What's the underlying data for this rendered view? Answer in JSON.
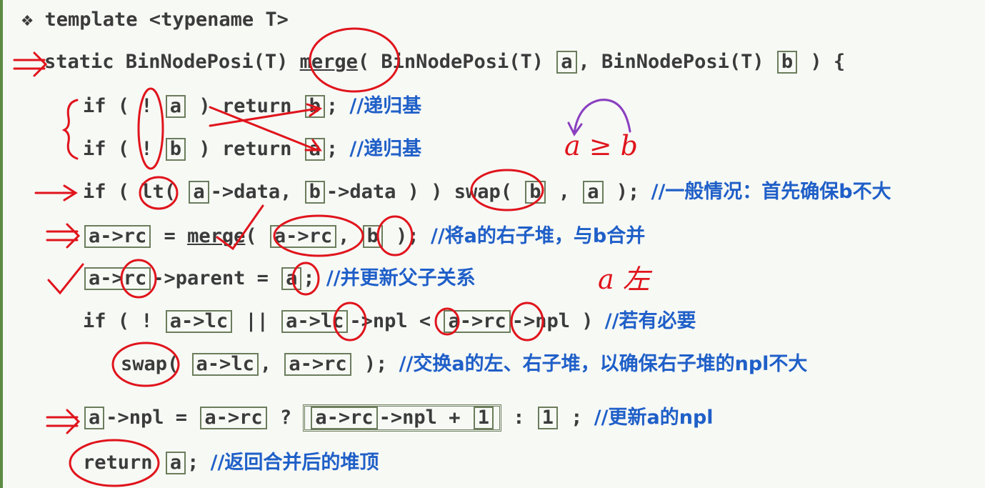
{
  "lines": {
    "l1": "❖ template <typename T>",
    "l2a": "static BinNodePosi(T) ",
    "l2b": "merge",
    "l2c": "( BinNodePosi(T) ",
    "l2d": "a",
    "l2e": ", BinNodePosi(T) ",
    "l2f": "b",
    "l2g": " ) {",
    "l3a": "if ( ! ",
    "l3b": "a",
    "l3c": " ) return ",
    "l3d": "b",
    "l3e": "; ",
    "l3f": "//递归基",
    "l4a": "if ( ! ",
    "l4b": "b",
    "l4c": " ) return ",
    "l4d": "a",
    "l4e": "; ",
    "l4f": "//递归基",
    "l5a": "if ( lt( ",
    "l5b": "a",
    "l5c": "->data, ",
    "l5d": "b",
    "l5e": "->data ) ) swap( ",
    "l5f": "b",
    "l5g": " , ",
    "l5h": "a",
    "l5i": " ); ",
    "l5j": "//一般情况：首先确保b不大",
    "l6a": "a->rc",
    "l6b": " = ",
    "l6c": "merge",
    "l6d": "( ",
    "l6e": "a->rc",
    "l6f": ", ",
    "l6g": "b",
    "l6h": " ); ",
    "l6i": "//将a的右子堆，与b合并",
    "l7a": "a->rc",
    "l7b": "->parent = ",
    "l7c": "a",
    "l7d": "; ",
    "l7e": "//并更新父子关系",
    "l8a": "if ( ! ",
    "l8b": "a->lc",
    "l8c": " || ",
    "l8d": "a->lc",
    "l8e": "->npl < ",
    "l8f": "a->rc",
    "l8g": "->npl ) ",
    "l8h": "//若有必要",
    "l9a": "swap( ",
    "l9b": "a->lc",
    "l9c": ", ",
    "l9d": "a->rc",
    "l9e": " ); ",
    "l9f": "//交换a的左、右子堆，以确保右子堆的npl不大",
    "l10a": "a",
    "l10b": "->npl = ",
    "l10c": "a->rc",
    "l10d": " ? ",
    "l10e": "a->rc",
    "l10f": "->npl + ",
    "l10g": "1",
    "l10h": " : ",
    "l10i": "1",
    "l10j": " ; ",
    "l10k": "//更新a的npl",
    "l11a": "return",
    "l11b": " ",
    "l11c": "a",
    "l11d": "; ",
    "l11e": "//返回合并后的堆顶"
  },
  "annotations": {
    "a_ge_b": "a ≥ b",
    "a_left": "a 左"
  },
  "colors": {
    "code": "#3b3b3b",
    "comment": "#1f5fc8",
    "ink": "#e0141c",
    "purple": "#8a3fc0",
    "frame": "#5c8a43"
  }
}
